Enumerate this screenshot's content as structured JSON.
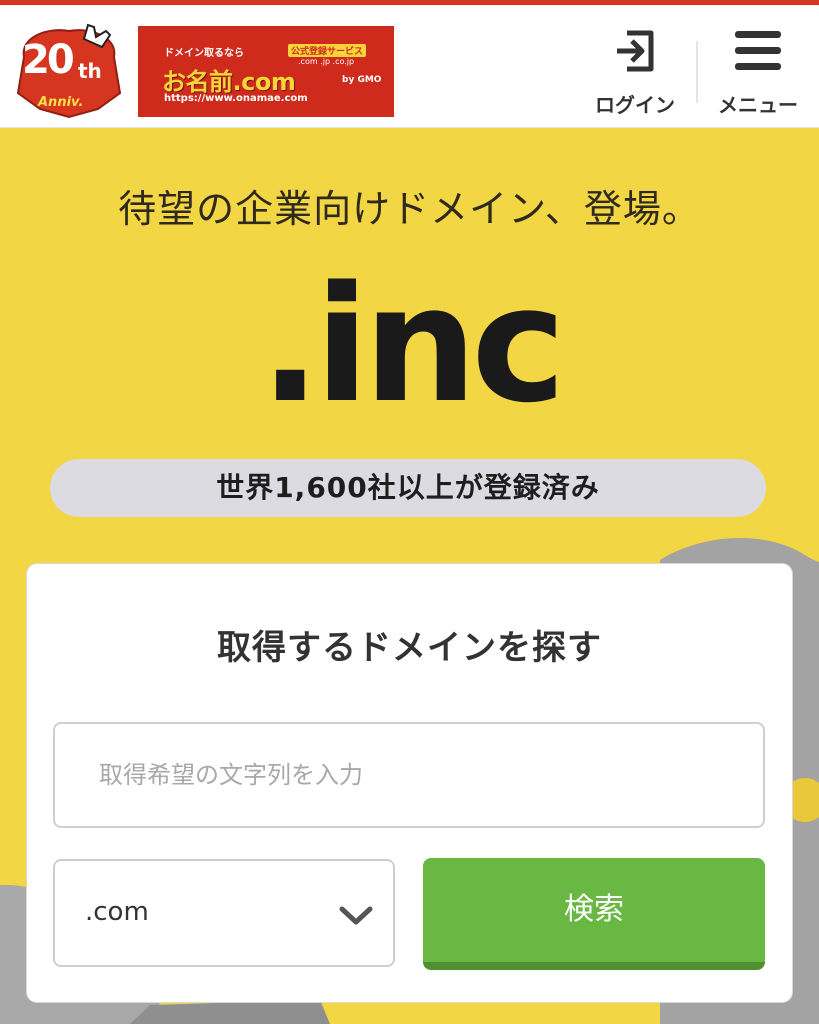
{
  "header": {
    "anniversary": {
      "number": "20",
      "suffix": "th",
      "sub": "Anniv."
    },
    "brand": {
      "tagline": "ドメイン取るなら",
      "badge": "公式登録サービス",
      "tlds": ".com .jp .co.jp",
      "name": "お名前.com",
      "by": "by GMO",
      "url": "https://www.onamae.com"
    },
    "login_label": "ログイン",
    "menu_label": "メニュー"
  },
  "hero": {
    "tagline": "待望の企業向けドメイン、登場。",
    "tld": ".inc",
    "registered_badge": "世界1,600社以上が登録済み"
  },
  "search": {
    "title": "取得するドメインを探す",
    "placeholder": "取得希望の文字列を入力",
    "tld_value": ".com",
    "button_label": "検索"
  },
  "colors": {
    "hero_bg": "#f2d644",
    "header_accent": "#d6351f",
    "brand_red": "#cf2b1d",
    "search_green": "#6ab844"
  },
  "icons": {
    "login": "login-icon",
    "menu": "hamburger-icon",
    "select": "chevron-down-icon"
  }
}
